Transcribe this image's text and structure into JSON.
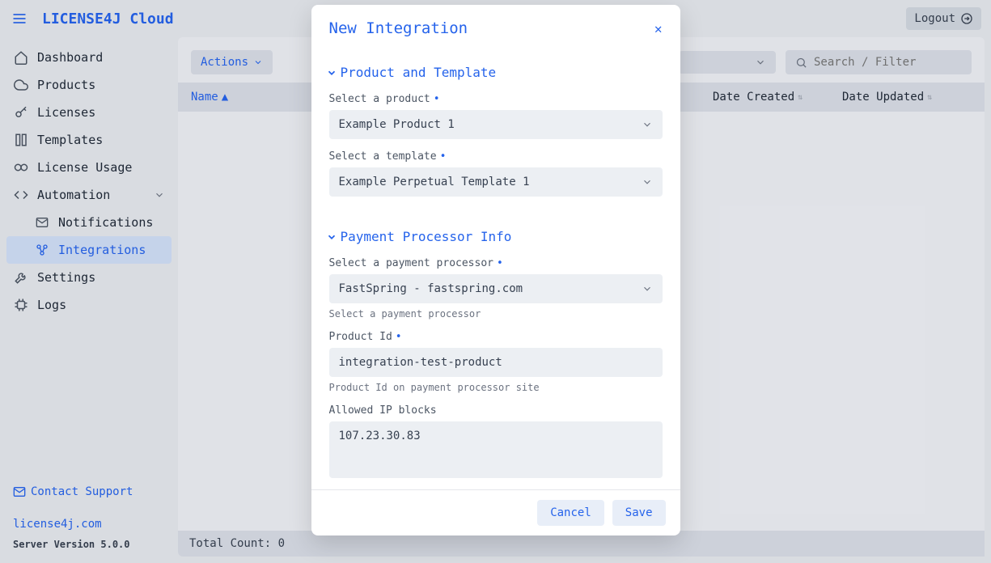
{
  "header": {
    "brand": "LICENSE4J Cloud",
    "logout": "Logout"
  },
  "sidebar": {
    "items": {
      "dashboard": "Dashboard",
      "products": "Products",
      "licenses": "Licenses",
      "templates": "Templates",
      "usage": "License Usage",
      "automation": "Automation",
      "notifications": "Notifications",
      "integrations": "Integrations",
      "settings": "Settings",
      "logs": "Logs"
    },
    "contact": "Contact Support",
    "site_link": "license4j.com",
    "version": "Server Version 5.0.0"
  },
  "toolbar": {
    "actions": "Actions",
    "search_placeholder": "Search / Filter"
  },
  "table": {
    "cols": {
      "name": "Name",
      "created": "Date Created",
      "updated": "Date Updated"
    },
    "total_label": "Total Count: 0"
  },
  "modal": {
    "title": "New Integration",
    "section_product": "Product and Template",
    "product_label": "Select a product",
    "product_value": "Example Product 1",
    "template_label": "Select a template",
    "template_value": "Example Perpetual Template 1",
    "section_processor": "Payment Processor Info",
    "processor_label": "Select a payment processor",
    "processor_value": "FastSpring - fastspring.com",
    "processor_help": "Select a payment processor",
    "productid_label": "Product Id",
    "productid_value": "integration-test-product",
    "productid_help": "Product Id on payment processor site",
    "ip_label": "Allowed IP blocks",
    "ip_value": "107.23.30.83",
    "cancel": "Cancel",
    "save": "Save"
  }
}
